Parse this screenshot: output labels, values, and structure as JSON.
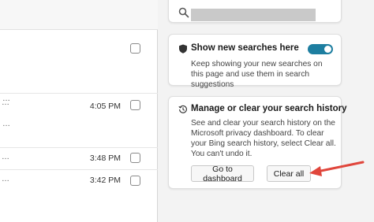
{
  "history_list": {
    "rows": [
      {
        "time": "",
        "has_dots": false
      },
      {
        "time": "4:05 PM",
        "has_dots": true
      },
      {
        "time": "3:48 PM",
        "has_dots": true
      },
      {
        "time": "3:42 PM",
        "has_dots": true
      }
    ]
  },
  "search_card": {
    "query": ""
  },
  "show_new_searches": {
    "title": "Show new searches here",
    "description": "Keep showing your new searches on this page and use them in search suggestions",
    "toggle_on": true,
    "toggle_color": "#1d7ea0"
  },
  "manage_history": {
    "title": "Manage or clear your search history",
    "description": "See and clear your search history on the Microsoft privacy dashboard. To clear your Bing search history, select Clear all. You can't undo it.",
    "dashboard_button": "Go to dashboard",
    "clear_button": "Clear all"
  },
  "annotation": {
    "arrow_color": "#e0463c"
  }
}
